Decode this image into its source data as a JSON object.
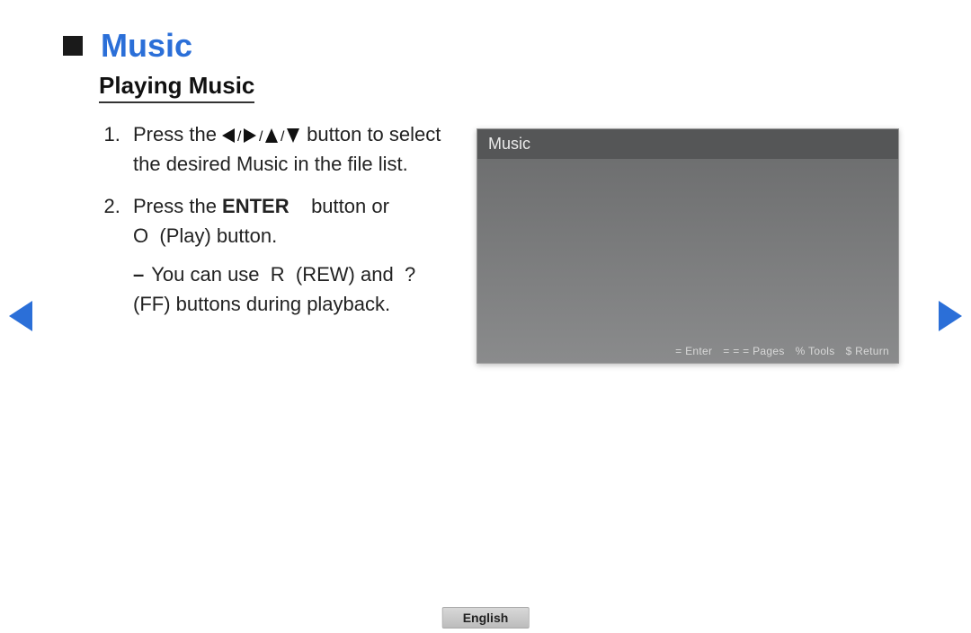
{
  "title": "Music",
  "subtitle": "Playing Music",
  "steps": {
    "s1_a": "Press the ",
    "s1_b": " button to select the desired Music in the file list.",
    "s2_a": "Press the ",
    "s2_enter": "ENTER",
    "s2_b": " button or ",
    "s2_play_sym": "O",
    "s2_c": " (Play) button.",
    "sub_dash": "–",
    "sub_a": "You can use ",
    "sub_rew_sym": "R",
    "sub_b": " (REW) and ",
    "sub_ff_sym": "?",
    "sub_c": " (FF) buttons during playback."
  },
  "screenshot": {
    "header": "Music",
    "footer": {
      "enter": "= Enter",
      "pages": "= = = Pages",
      "tools": "% Tools",
      "ret": "$ Return"
    }
  },
  "language": "English"
}
